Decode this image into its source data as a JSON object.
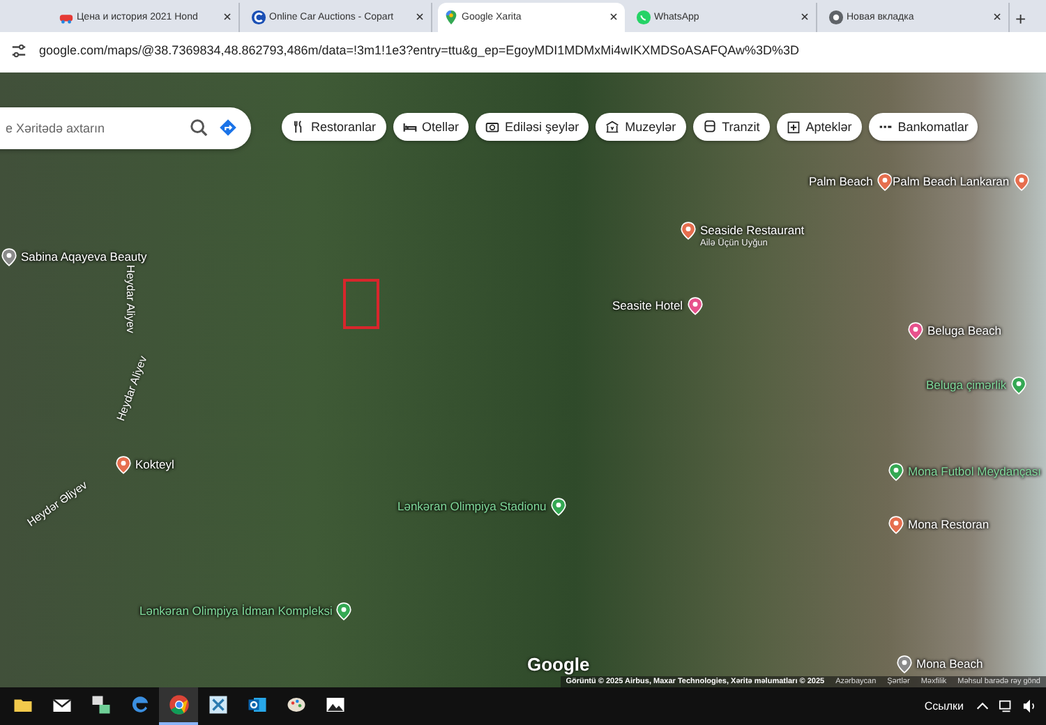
{
  "browser": {
    "tabs": [
      {
        "title": "Цена и история 2021 Hond",
        "selected": false,
        "kind": "car"
      },
      {
        "title": "Online Car Auctions - Copart",
        "selected": false,
        "kind": "copart"
      },
      {
        "title": "Google Xarita",
        "selected": true,
        "kind": "maps"
      },
      {
        "title": "WhatsApp",
        "selected": false,
        "kind": "whatsapp"
      },
      {
        "title": "Новая вкладка",
        "selected": false,
        "kind": "chrome"
      }
    ],
    "new_tab": "+",
    "url": "google.com/maps/@38.7369834,48.862793,486m/data=!3m1!1e3?entry=ttu&g_ep=EgoyMDI1MDMxMi4wIKXMDSoASAFQAw%3D%3D"
  },
  "map": {
    "search": {
      "placeholder": "e Xəritədə axtarın"
    },
    "chips": [
      {
        "label": "Restoranlar",
        "kind": "fork"
      },
      {
        "label": "Otellər",
        "kind": "bed"
      },
      {
        "label": "Ediləsi şeylər",
        "kind": "camera"
      },
      {
        "label": "Muzeylər",
        "kind": "museum"
      },
      {
        "label": "Tranzit",
        "kind": "bus"
      },
      {
        "label": "Apteklər",
        "kind": "pharmacy"
      },
      {
        "label": "Bankomatlar",
        "kind": "atm"
      }
    ],
    "places": [
      {
        "name": "Palm Beach",
        "kind": "food"
      },
      {
        "name": "Palm Beach Lankaran",
        "kind": "food"
      },
      {
        "name": "Seaside Restaurant",
        "note": "Ailə Üçün Uyğun",
        "kind": "food"
      },
      {
        "name": "Sabina Aqayeva Beauty",
        "kind": "generic"
      },
      {
        "name": "Seasite Hotel",
        "kind": "hotel"
      },
      {
        "name": "Beluga Beach",
        "kind": "hotel"
      },
      {
        "name": "Beluga çimərlik",
        "kind": "park"
      },
      {
        "name": "Kokteyl",
        "kind": "food"
      },
      {
        "name": "Lənkəran Olimpiya Stadionu",
        "kind": "park"
      },
      {
        "name": "Lənkəran Olimpiya İdman Kompleksi",
        "kind": "park"
      },
      {
        "name": "Mona Futbol Meydançası",
        "kind": "park"
      },
      {
        "name": "Mona Restoran",
        "kind": "food"
      },
      {
        "name": "Mona Beach",
        "kind": "generic"
      }
    ],
    "streets": [
      "Heydar Aliyev",
      "Heydar Aliyev",
      "Heydər Əliyev"
    ],
    "logo": "Google",
    "footer": [
      "Görüntü © 2025 Airbus, Maxar Technologies, Xəritə məlumatları © 2025",
      "Azərbaycan",
      "Şərtlər",
      "Məxfilik",
      "Məhsul barədə rəy gönd"
    ]
  },
  "taskbar": {
    "apps": [
      {
        "kind": "folder",
        "selected": false
      },
      {
        "kind": "mail",
        "selected": false
      },
      {
        "kind": "files",
        "selected": false
      },
      {
        "kind": "edge",
        "selected": false
      },
      {
        "kind": "chrome",
        "selected": true
      },
      {
        "kind": "app",
        "selected": false
      },
      {
        "kind": "outlook",
        "selected": false
      },
      {
        "kind": "paint",
        "selected": false
      },
      {
        "kind": "photos",
        "selected": false
      }
    ],
    "links": "Ссылки"
  }
}
